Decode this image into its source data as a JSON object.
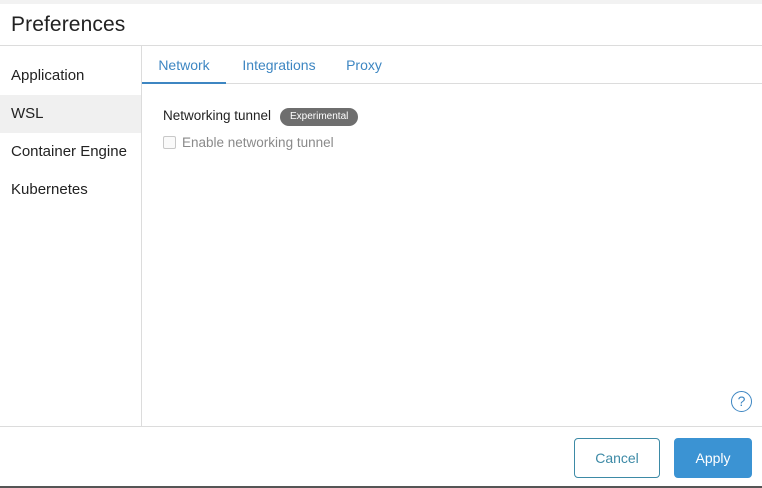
{
  "window": {
    "title": "Preferences"
  },
  "sidebar": {
    "items": [
      {
        "label": "Application",
        "active": false
      },
      {
        "label": "WSL",
        "active": true
      },
      {
        "label": "Container Engine",
        "active": false
      },
      {
        "label": "Kubernetes",
        "active": false
      }
    ]
  },
  "tabs": [
    {
      "label": "Network",
      "active": true
    },
    {
      "label": "Integrations",
      "active": false
    },
    {
      "label": "Proxy",
      "active": false
    }
  ],
  "network": {
    "section_label": "Networking tunnel",
    "badge": "Experimental",
    "checkbox_label": "Enable networking tunnel",
    "checkbox_checked": false,
    "checkbox_disabled": true
  },
  "help": {
    "icon": "question-circle-icon",
    "glyph": "?"
  },
  "footer": {
    "cancel_label": "Cancel",
    "apply_label": "Apply"
  },
  "colors": {
    "accent": "#3d86c2",
    "apply_bg": "#3b93d3",
    "badge_bg": "#6e6e6e"
  }
}
